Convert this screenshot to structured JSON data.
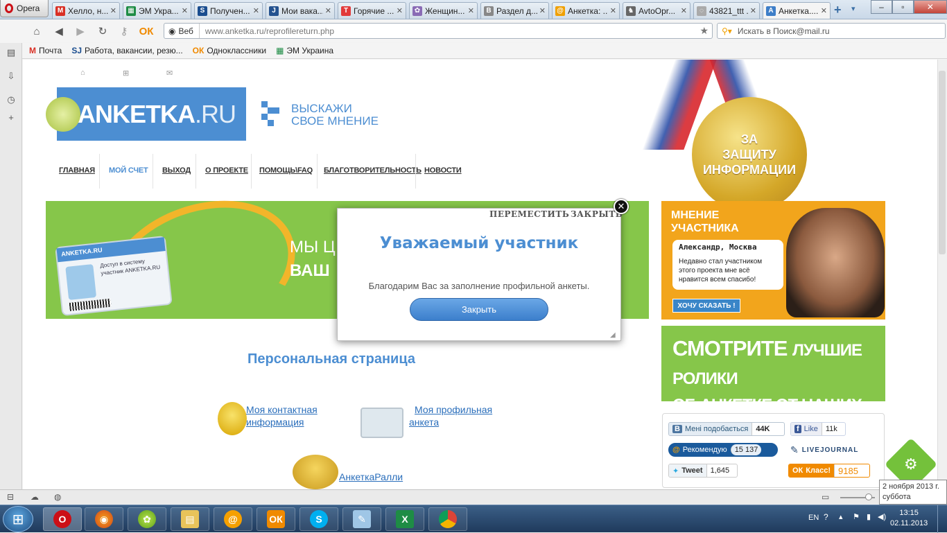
{
  "browser": {
    "opera_label": "Opera",
    "tabs": [
      {
        "title": "Хелло, н...",
        "favicon": "gmail-icon",
        "color": "#d93025",
        "glyph": "M"
      },
      {
        "title": "ЭМ Укра...",
        "favicon": "sheet-icon",
        "color": "#1e8c45",
        "glyph": "▦"
      },
      {
        "title": "Получен...",
        "favicon": "sj-icon",
        "color": "#1a4d8f",
        "glyph": "S"
      },
      {
        "title": "Мои вака...",
        "favicon": "jl-icon",
        "color": "#24528f",
        "glyph": "J"
      },
      {
        "title": "Горячие ...",
        "favicon": "hot-icon",
        "color": "#e23a3a",
        "glyph": "T"
      },
      {
        "title": "Женщин...",
        "favicon": "flower-icon",
        "color": "#8a6bb5",
        "glyph": "✿"
      },
      {
        "title": "Раздел д...",
        "favicon": "b-icon",
        "color": "#888888",
        "glyph": "B"
      },
      {
        "title": "Анкетка: ...",
        "favicon": "at-icon",
        "color": "#f0a000",
        "glyph": "@"
      },
      {
        "title": "AvtoOpr...",
        "favicon": "car-icon",
        "color": "#666666",
        "glyph": "♞"
      },
      {
        "title": "43821_ttt ...",
        "favicon": "loading-icon",
        "color": "#aaaaaa",
        "glyph": "◌"
      },
      {
        "title": "Анкетка....",
        "favicon": "a-icon",
        "color": "#3d7ec8",
        "glyph": "A"
      }
    ],
    "address": {
      "scheme_label": "Веб",
      "url": "www.anketka.ru/reprofilereturn.php"
    },
    "search_placeholder": "Искать в Поиск@mail.ru",
    "bookmarks": [
      {
        "label": "Почта",
        "icon": "gmail-icon",
        "glyph": "M",
        "color": "#d93025"
      },
      {
        "label": "Работа, вакансии, резю...",
        "icon": "sj-icon",
        "glyph": "SJ",
        "color": "#1a4d8f"
      },
      {
        "label": "Одноклассники",
        "icon": "ok-icon",
        "glyph": "ОК",
        "color": "#f08a00"
      },
      {
        "label": "ЭМ Украина",
        "icon": "sheet-icon",
        "glyph": "▦",
        "color": "#1e8c45"
      }
    ]
  },
  "site": {
    "logo": {
      "main": "ANKETKA",
      "suffix": ".RU"
    },
    "tagline": {
      "line1": "ВЫСКАЖИ",
      "line2": "СВОЕ МНЕНИЕ"
    },
    "nav": [
      "ГЛАВНАЯ",
      "МОЙ СЧЕТ",
      "ВЫХОД",
      "О ПРОЕКТЕ",
      "ПОМОЩЬ\\FAQ",
      "БЛАГОТВОРИТЕЛЬНОСТЬ",
      "НОВОСТИ"
    ],
    "nav_active": "МОЙ СЧЕТ",
    "banner": {
      "line1": "МЫ Ц",
      "line2": "ВАШ"
    },
    "medal": {
      "line1": "ЗА",
      "line2": "ЗАЩИТУ",
      "line3": "ИНФОРМАЦИИ"
    },
    "opinion": {
      "title1": "МНЕНИЕ",
      "title2": "УЧАСТНИКА",
      "author": "Александр, Москва",
      "quote": "Недавно стал участником этого проекта мне всё нравится всем спасибо!",
      "button": "ХОЧУ СКАЗАТЬ !"
    },
    "videos": {
      "big1": "СМОТРИТЕ",
      "small1": "ЛУЧШИЕ РОЛИКИ",
      "line2": "ОБ АНКЕТКЕ ОТ НАШИХ УЧАСТНИКОВ!"
    },
    "social": {
      "vk": {
        "label": "Мені подобається",
        "count": "44K"
      },
      "fb": {
        "label": "Like",
        "count": "11k"
      },
      "mailru": {
        "label": "Рекомендую",
        "count": "15 137"
      },
      "lj": {
        "label": "LIVEJOURNAL"
      },
      "tweet": {
        "label": "Tweet",
        "count": "1,645"
      },
      "ok": {
        "label": "Класс!",
        "count": "9185"
      }
    },
    "personal": {
      "title": "Персональная страница",
      "contact": "Моя контактная информация",
      "profile": "Моя профильная анкета",
      "rally": "АнкеткаРалли"
    },
    "badge": {
      "logo": "ANKETKA.RU",
      "line1": "Доступ в систему",
      "line2": "участник ANKETKA.RU"
    }
  },
  "modal": {
    "move_label": "ПЕРЕМЕСТИТЬ",
    "close_label": "ЗАКРЫТЬ",
    "title": "Уважаемый участник",
    "message": "Благодарим Вас за заполнение профильной анкеты.",
    "button": "Закрыть"
  },
  "taskbar": {
    "lang": "EN",
    "time": "13:15",
    "date": "02.11.2013",
    "tooltip_line1": "2 ноября 2013 г.",
    "tooltip_line2": "суббота"
  }
}
